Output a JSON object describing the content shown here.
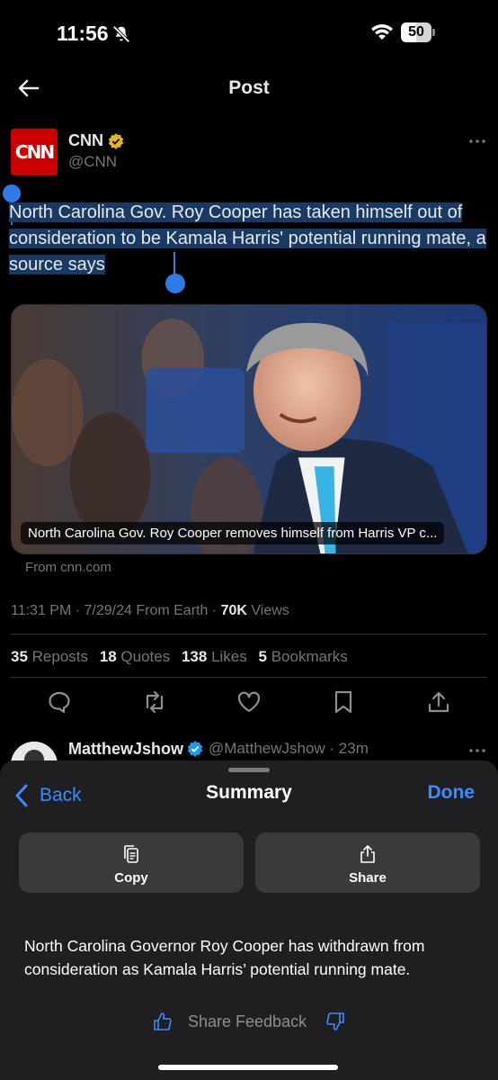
{
  "status_bar": {
    "time": "11:56",
    "battery": "50",
    "battery_level": 0.5
  },
  "nav": {
    "title": "Post"
  },
  "post": {
    "author_name": "CNN",
    "author_handle": "@CNN",
    "avatar_text": "CNN",
    "text": "North Carolina Gov. Roy Cooper has taken himself out of consideration to be Kamala Harris' potential running mate, a source says",
    "card_caption": "North Carolina Gov. Roy Cooper removes himself from Harris VP c...",
    "card_source": "From cnn.com",
    "timestamp": "11:31 PM · 7/29/24 From Earth · ",
    "views_count": "70K",
    "views_label": " Views",
    "stats": [
      {
        "count": "35",
        "label": "Reposts"
      },
      {
        "count": "18",
        "label": "Quotes"
      },
      {
        "count": "138",
        "label": "Likes"
      },
      {
        "count": "5",
        "label": "Bookmarks"
      }
    ]
  },
  "reply": {
    "name": "MatthewJshow",
    "handle": "@MatthewJshow · 23m"
  },
  "sheet": {
    "back_label": "Back",
    "title": "Summary",
    "done_label": "Done",
    "copy_label": "Copy",
    "share_label": "Share",
    "summary": "North Carolina Governor Roy Cooper has withdrawn from consideration as Kamala Harris’ potential running mate.",
    "feedback_label": "Share Feedback"
  },
  "colors": {
    "accent": "#3a8dff",
    "selection_handle": "#2f7ae5",
    "verified_gold": "#e2b719",
    "verified_blue": "#1d9bf0",
    "cnn_red": "#cc0000"
  }
}
